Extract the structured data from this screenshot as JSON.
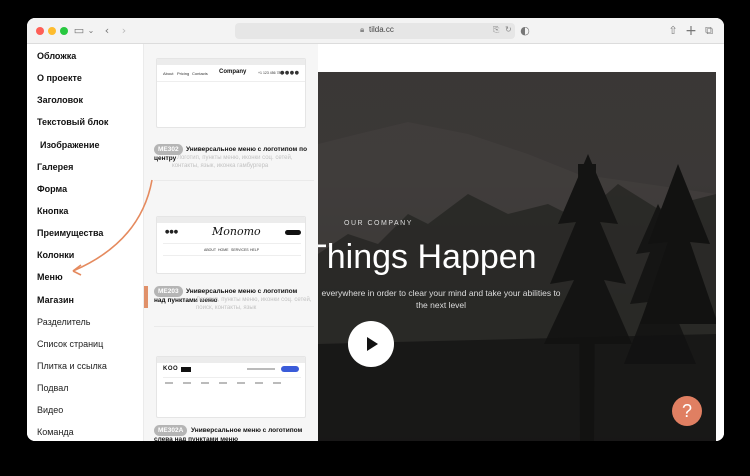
{
  "browser": {
    "url": "tilda.cc",
    "lock_icon": "lock-icon",
    "dots": [
      "#fe5f57",
      "#febc2e",
      "#28c840"
    ]
  },
  "sidebar": {
    "items": [
      {
        "label": "Обложка"
      },
      {
        "label": "О проекте"
      },
      {
        "label": "Заголовок"
      },
      {
        "label": "Текстовый блок"
      },
      {
        "label": "Изображение"
      },
      {
        "label": "Галерея"
      },
      {
        "label": "Форма"
      },
      {
        "label": "Кнопка"
      },
      {
        "label": "Преимущества"
      },
      {
        "label": "Колонки"
      },
      {
        "label": "Меню"
      },
      {
        "label": "Магазин"
      },
      {
        "label": "Разделитель"
      },
      {
        "label": "Список страниц"
      },
      {
        "label": "Плитка и ссылка"
      },
      {
        "label": "Подвал"
      },
      {
        "label": "Видео"
      },
      {
        "label": "Команда"
      }
    ]
  },
  "cards": [
    {
      "badge": "ME302",
      "title": "Универсальное меню с логотипом по центру",
      "desc": "Логотип, пункты меню, иконки соц. сетей, контакты, язык, иконка гамбургера",
      "preview": {
        "links": [
          "About",
          "Pricing",
          "Contacts"
        ],
        "logo": "Company",
        "phone": "+1 123 456 7890"
      }
    },
    {
      "badge": "ME203",
      "title": "Универсальное меню с логотипом над пунктами меню",
      "desc": "Логотип, пункты меню, иконки соц. сетей, поиск, контакты, язык",
      "preview": {
        "logo": "Monomo",
        "links": [
          "ABOUT",
          "HOME",
          "SERVICES",
          "HELP"
        ]
      }
    },
    {
      "badge": "ME302A",
      "title": "Универсальное меню с логотипом слева над пунктами меню",
      "desc": "",
      "preview": {
        "logo": "KOO"
      }
    }
  ],
  "hero": {
    "eyebrow": "OUR COMPANY",
    "headline": "Things Happen",
    "sub": "everywhere in order to clear your mind and take your abilities to the next level",
    "help": "?"
  },
  "colors": {
    "accent": "#e0916a",
    "help": "#e07f62"
  }
}
